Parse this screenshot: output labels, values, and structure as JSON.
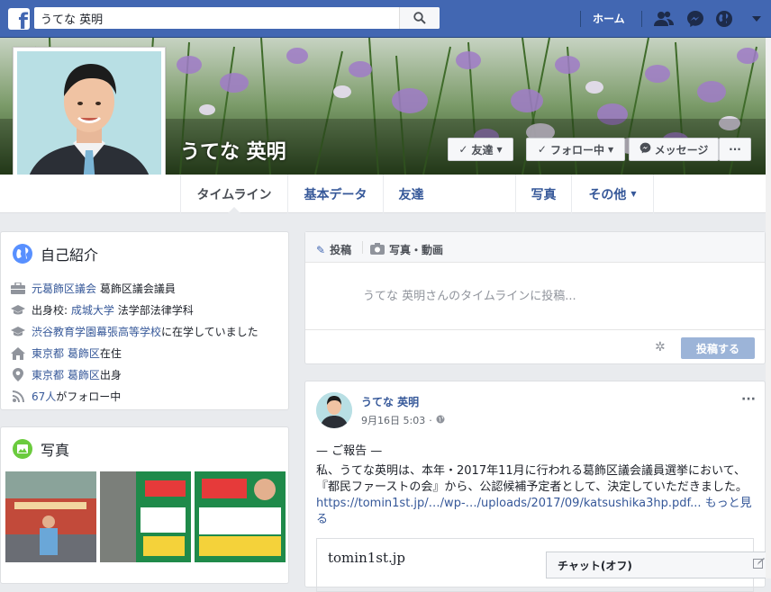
{
  "topbar": {
    "search_value": "うてな 英明",
    "home_label": "ホーム"
  },
  "profile": {
    "name": "うてな 英明",
    "buttons": {
      "friend": "友達",
      "follow": "フォロー中",
      "message": "メッセージ",
      "more": "···"
    }
  },
  "nav": {
    "tabs": [
      "タイムライン",
      "基本データ",
      "友達",
      "写真",
      "その他"
    ]
  },
  "intro": {
    "title": "自己紹介",
    "rows": [
      {
        "icon": "briefcase-icon",
        "link": "元葛飾区議会",
        "text": " 葛飾区議会議員"
      },
      {
        "icon": "graduation-cap-icon",
        "prefix": "出身校: ",
        "link": "成城大学",
        "text": " 法学部法律学科"
      },
      {
        "icon": "graduation-cap-icon",
        "link": "渋谷教育学園幕張高等学校",
        "text": "に在学していました"
      },
      {
        "icon": "home-icon",
        "link": "東京都 葛飾区",
        "text": "在住"
      },
      {
        "icon": "location-pin-icon",
        "link": "東京都 葛飾区",
        "text": "出身"
      },
      {
        "icon": "rss-icon",
        "link": "67人",
        "text": "がフォロー中"
      }
    ]
  },
  "photos": {
    "title": "写真"
  },
  "composer": {
    "tab_post": "投稿",
    "tab_photo": "写真・動画",
    "placeholder": "うてな 英明さんのタイムラインに投稿...",
    "submit": "投稿する"
  },
  "post": {
    "author": "うてな 英明",
    "date": "9月16日 5:03",
    "line1": "— ご報告 —",
    "body": "私、うてな英明は、本年・2017年11月に行われる葛飾区議会議員選挙において、『都民ファーストの会』から、公認候補予定者として、決定していただきました。",
    "link": "https://tomin1st.jp/…/wp-…/uploads/2017/09/katsushika3hp.pdf...",
    "more": "もっと見る",
    "preview_domain": "tomin1st.jp"
  },
  "chat": {
    "label": "チャット(オフ)"
  },
  "colors": {
    "brand": "#4267b2",
    "link": "#365899",
    "button_disabled": "#9cb4d8"
  }
}
